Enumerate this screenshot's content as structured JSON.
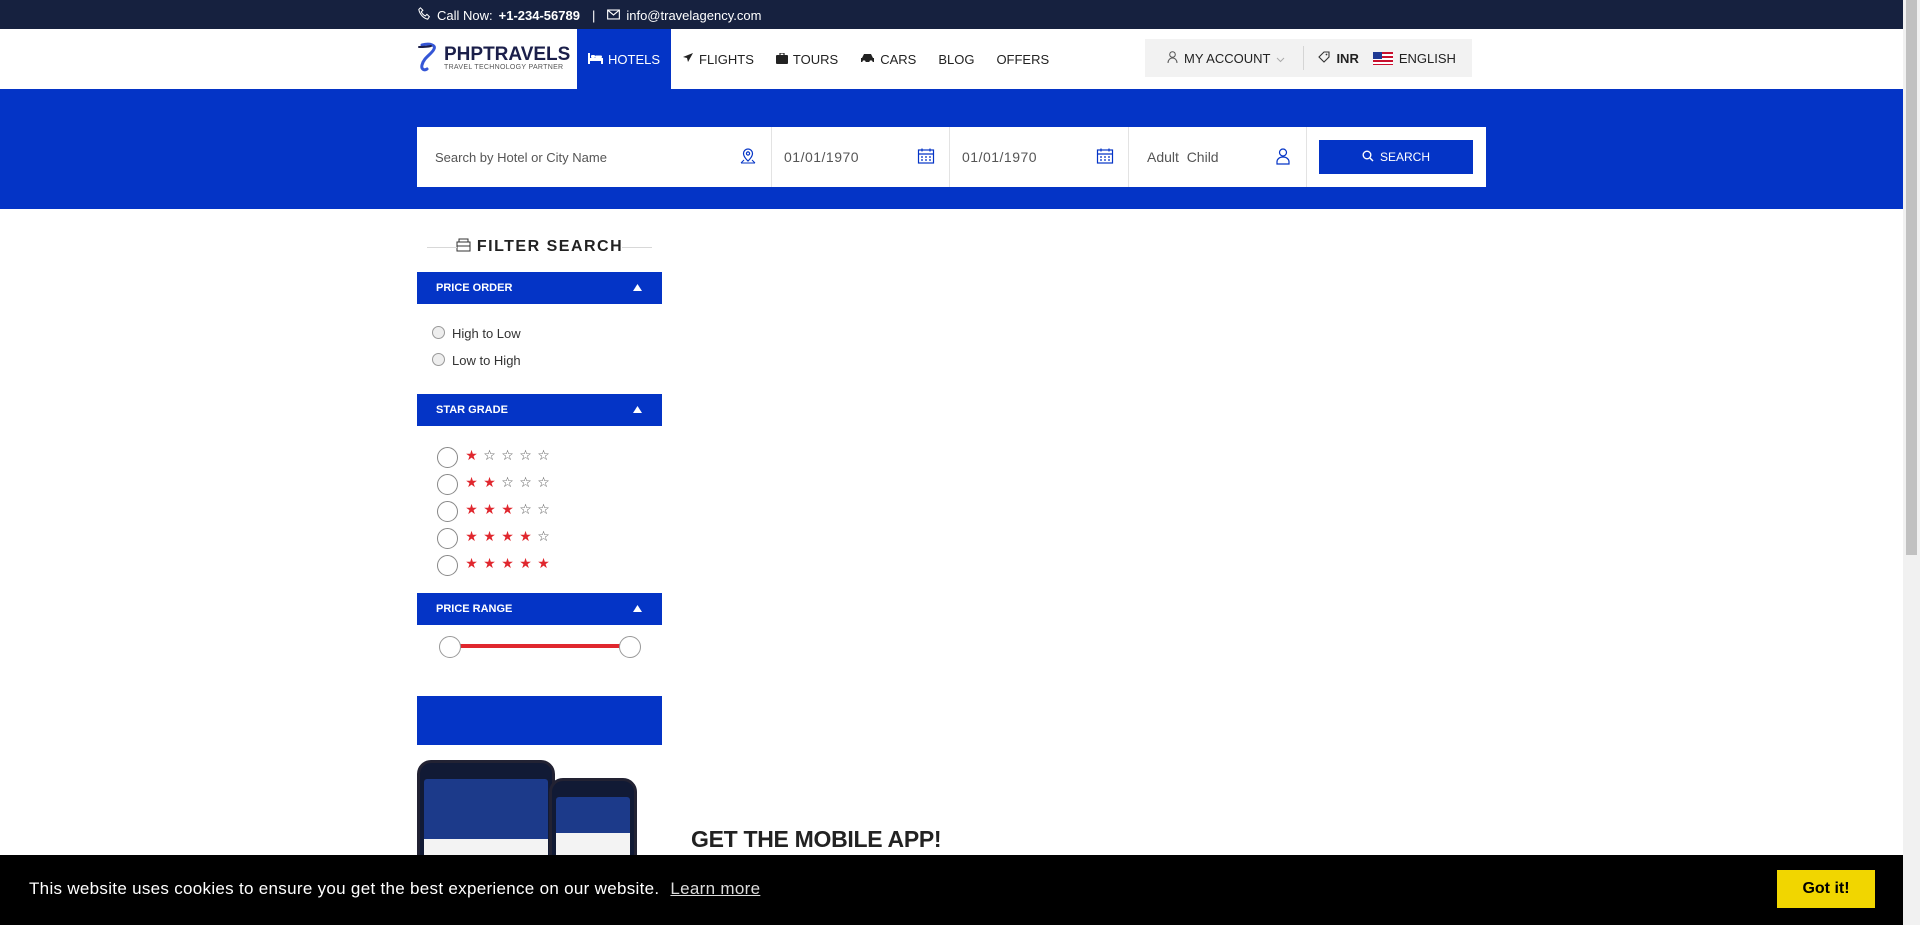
{
  "topbar": {
    "call_label": "Call Now:",
    "phone": "+1-234-56789",
    "separator": "|",
    "email": "info@travelagency.com"
  },
  "header": {
    "logo_name": "PHPTRAVELS",
    "logo_tagline": "TRAVEL TECHNOLOGY PARTNER",
    "nav": [
      {
        "label": "HOTELS",
        "icon": "bed-icon",
        "active": true
      },
      {
        "label": "FLIGHTS",
        "icon": "plane-icon"
      },
      {
        "label": "TOURS",
        "icon": "suitcase-icon"
      },
      {
        "label": "CARS",
        "icon": "car-icon"
      },
      {
        "label": "BLOG"
      },
      {
        "label": "OFFERS"
      }
    ],
    "account_label": "MY ACCOUNT",
    "currency": "INR",
    "language": "ENGLISH"
  },
  "search": {
    "destination_placeholder": "Search by Hotel or City Name",
    "checkin": "01/01/1970",
    "checkout": "01/01/1970",
    "guests": "Adult  Child",
    "button_label": "SEARCH"
  },
  "sidebar": {
    "filter_title": "FILTER SEARCH",
    "price_order": {
      "heading": "PRICE ORDER",
      "options": [
        "High to Low",
        "Low to High"
      ]
    },
    "star_grade": {
      "heading": "STAR GRADE",
      "ratings": [
        1,
        2,
        3,
        4,
        5
      ],
      "max": 5
    },
    "price_range": {
      "heading": "PRICE RANGE",
      "min_fraction": 0,
      "max_fraction": 1
    }
  },
  "mobile_app": {
    "title": "GET THE MOBILE APP!"
  },
  "cookie": {
    "message": "This website uses cookies to ensure you get the best experience on our website.",
    "learn_more": "Learn more",
    "button": "Got it!"
  },
  "colors": {
    "primary": "#0434c6",
    "topbar": "#16213f",
    "star": "#e0272e",
    "cookie_button": "#f1d600"
  }
}
